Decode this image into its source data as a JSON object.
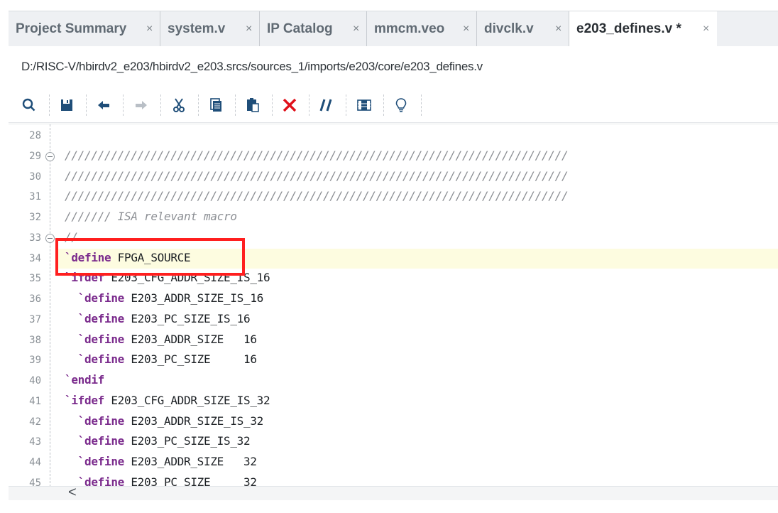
{
  "tabs": [
    {
      "label": "Project Summary",
      "close": "×",
      "active": false
    },
    {
      "label": "system.v",
      "close": "×",
      "active": false
    },
    {
      "label": "IP Catalog",
      "close": "×",
      "active": false
    },
    {
      "label": "mmcm.veo",
      "close": "×",
      "active": false
    },
    {
      "label": "divclk.v",
      "close": "×",
      "active": false
    },
    {
      "label": "e203_defines.v *",
      "close": "×",
      "active": true
    }
  ],
  "file_path": "D:/RISC-V/hbirdv2_e203/hbirdv2_e203.srcs/sources_1/imports/e203/core/e203_defines.v",
  "toolbar": {
    "icons": [
      "search-icon",
      "save-icon",
      "undo-icon",
      "redo-icon",
      "cut-icon",
      "copy-icon",
      "paste-icon",
      "delete-icon",
      "comment-icon",
      "block-select-icon",
      "lightbulb-icon"
    ],
    "colors": {
      "accent": "#1f4e79",
      "delete": "#e0101a"
    }
  },
  "editor": {
    "lines": [
      {
        "n": "28",
        "text": ""
      },
      {
        "n": "29",
        "text": "////////////////////////////////////////////////////////////////////////////"
      },
      {
        "n": "30",
        "text": "////////////////////////////////////////////////////////////////////////////"
      },
      {
        "n": "31",
        "text": "////////////////////////////////////////////////////////////////////////////"
      },
      {
        "n": "32",
        "text": "/////// ISA relevant macro"
      },
      {
        "n": "33",
        "text": "//"
      },
      {
        "n": "34",
        "kw": "`define",
        "rest": " FPGA_SOURCE"
      },
      {
        "n": "35",
        "kw": "`ifdef",
        "rest": " E203_CFG_ADDR_SIZE_IS_16"
      },
      {
        "n": "36",
        "kw": "  `define",
        "rest": " E203_ADDR_SIZE_IS_16"
      },
      {
        "n": "37",
        "kw": "  `define",
        "rest": " E203_PC_SIZE_IS_16"
      },
      {
        "n": "38",
        "kw": "  `define",
        "rest": " E203_ADDR_SIZE   16"
      },
      {
        "n": "39",
        "kw": "  `define",
        "rest": " E203_PC_SIZE     16"
      },
      {
        "n": "40",
        "kw": "`endif",
        "rest": ""
      },
      {
        "n": "41",
        "kw": "`ifdef",
        "rest": " E203_CFG_ADDR_SIZE_IS_32"
      },
      {
        "n": "42",
        "kw": "  `define",
        "rest": " E203_ADDR_SIZE_IS_32"
      },
      {
        "n": "43",
        "kw": "  `define",
        "rest": " E203_PC_SIZE_IS_32"
      },
      {
        "n": "44",
        "kw": "  `define",
        "rest": " E203_ADDR_SIZE   32"
      },
      {
        "n": "45",
        "kw": "  `define",
        "rest": " E203_PC_SIZE     32"
      }
    ],
    "highlighted_line": "34"
  },
  "scrollbar": {
    "left_arrow": "<"
  }
}
